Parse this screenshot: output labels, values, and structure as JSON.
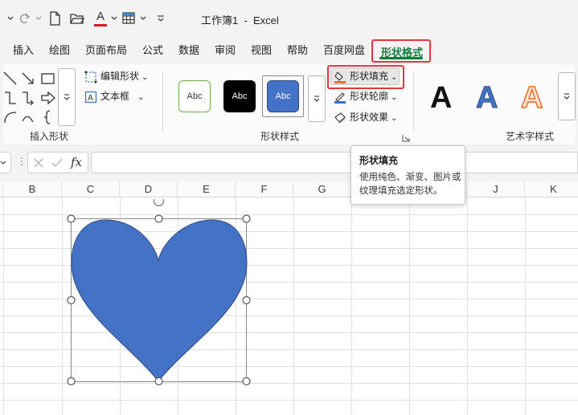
{
  "window": {
    "title": "工作簿1  -  Excel"
  },
  "quick_access": {
    "undo_icon": "undo-icon",
    "redo_icon": "redo-icon",
    "font_color_letter": "A",
    "font_color_accent": "#e81123"
  },
  "menu": {
    "tabs": [
      "插入",
      "绘图",
      "页面布局",
      "公式",
      "数据",
      "审阅",
      "视图",
      "帮助",
      "百度网盘"
    ],
    "active_tab": "形状格式",
    "active_color": "#107c41",
    "highlight_color": "#e0383e"
  },
  "ribbon": {
    "insert_shapes": {
      "edit_shape_label": "编辑形状",
      "textbox_label": "文本框",
      "group_label": "插入形状"
    },
    "shape_styles": {
      "previews": [
        {
          "text": "Abc",
          "style": "outline-green"
        },
        {
          "text": "Abc",
          "style": "black"
        },
        {
          "text": "Abc",
          "style": "blue-selected"
        }
      ],
      "fill_label": "形状填充",
      "outline_label": "形状轮廓",
      "effects_label": "形状效果",
      "group_label": "形状样式"
    },
    "wordart": {
      "letters": [
        "A",
        "A",
        "A"
      ],
      "group_label": "艺术字样式"
    }
  },
  "formula_bar": {
    "fx_label": "fx",
    "cancel_icon": "close-icon",
    "enter_icon": "check-icon"
  },
  "sheet": {
    "columns": [
      "B",
      "C",
      "D",
      "E",
      "F",
      "G",
      "H",
      "I",
      "J",
      "K"
    ],
    "shape": {
      "type": "heart",
      "fill": "#4472c4",
      "stroke": "#2f4a80"
    }
  },
  "tooltip": {
    "title": "形状填充",
    "body": "使用纯色、渐变、图片或纹理填充选定形状。"
  }
}
